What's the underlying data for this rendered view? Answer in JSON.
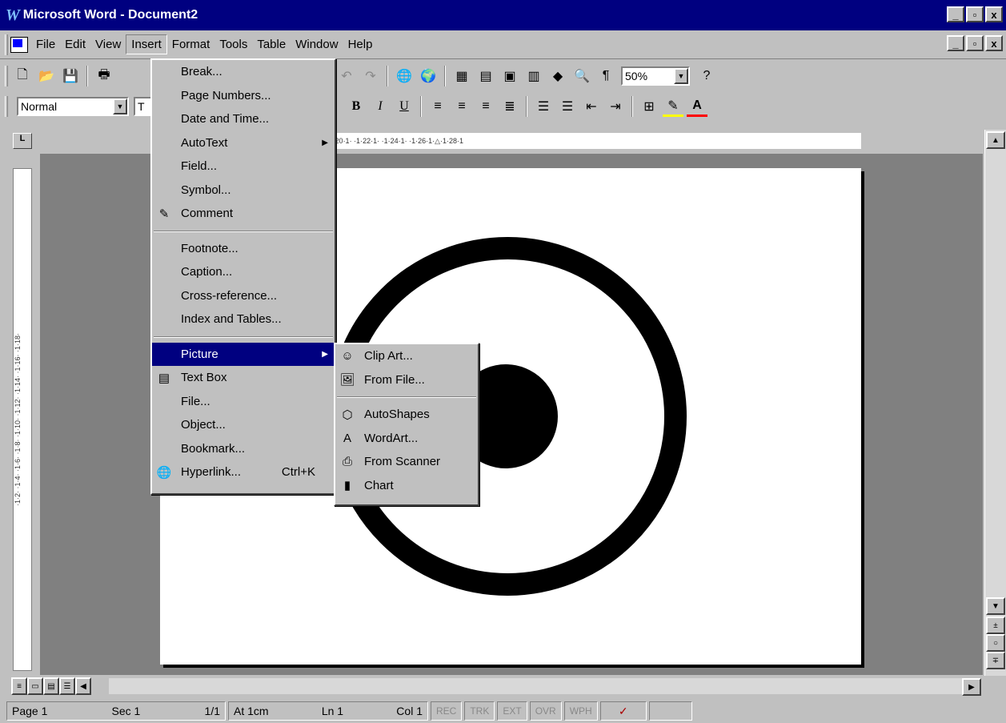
{
  "window": {
    "title": "Microsoft Word - Document2",
    "min": "_",
    "max": "▫",
    "close": "x"
  },
  "menubar": {
    "items": [
      "File",
      "Edit",
      "View",
      "Insert",
      "Format",
      "Tools",
      "Table",
      "Window",
      "Help"
    ],
    "active": "Insert"
  },
  "toolbar_standard": {
    "zoom": "50%"
  },
  "toolbar_formatting": {
    "style": "Normal",
    "font_partial": "T"
  },
  "ruler": {
    "h_labels": "· ·1·8·1· ·1·10·1· ·1·12·1· ·1·14·1· ·1·16·1· ·1·18·1· ·1·20·1· ·1·22·1· ·1·24·1· ·1·26·1·△·1·28·1",
    "v_labels": "·1·2· ·1·4· ·1·6· ·1·8· ·1·10· ·1·12· ·1·14· ·1·16· ·1·18·"
  },
  "insert_menu": {
    "items": [
      {
        "label": "Break..."
      },
      {
        "label": "Page Numbers..."
      },
      {
        "label": "Date and Time..."
      },
      {
        "label": "AutoText",
        "arrow": "▶"
      },
      {
        "label": "Field..."
      },
      {
        "label": "Symbol..."
      },
      {
        "label": "Comment",
        "icon": "comment-icon"
      },
      {
        "label": "Footnote..."
      },
      {
        "label": "Caption..."
      },
      {
        "label": "Cross-reference..."
      },
      {
        "label": "Index and Tables..."
      },
      {
        "label": "Picture",
        "arrow": "▶",
        "selected": true
      },
      {
        "label": "Text Box",
        "icon": "text-box-icon"
      },
      {
        "label": "File..."
      },
      {
        "label": "Object..."
      },
      {
        "label": "Bookmark..."
      },
      {
        "label": "Hyperlink...",
        "shortcut": "Ctrl+K",
        "icon": "hyperlink-icon"
      }
    ]
  },
  "picture_submenu": {
    "items": [
      {
        "label": "Clip Art...",
        "icon": "clip-art-icon"
      },
      {
        "label": "From File...",
        "icon": "from-file-icon"
      },
      {
        "label": "AutoShapes",
        "icon": "autoshapes-icon"
      },
      {
        "label": "WordArt...",
        "icon": "wordart-icon"
      },
      {
        "label": "From Scanner",
        "icon": "scanner-icon"
      },
      {
        "label": "Chart",
        "icon": "chart-icon"
      }
    ]
  },
  "statusbar": {
    "page": "Page 1",
    "sec": "Sec 1",
    "pos": "1/1",
    "at": "At 1cm",
    "ln": "Ln 1",
    "col": "Col 1",
    "rec": "REC",
    "trk": "TRK",
    "ext": "EXT",
    "ovr": "OVR",
    "wph": "WPH"
  }
}
